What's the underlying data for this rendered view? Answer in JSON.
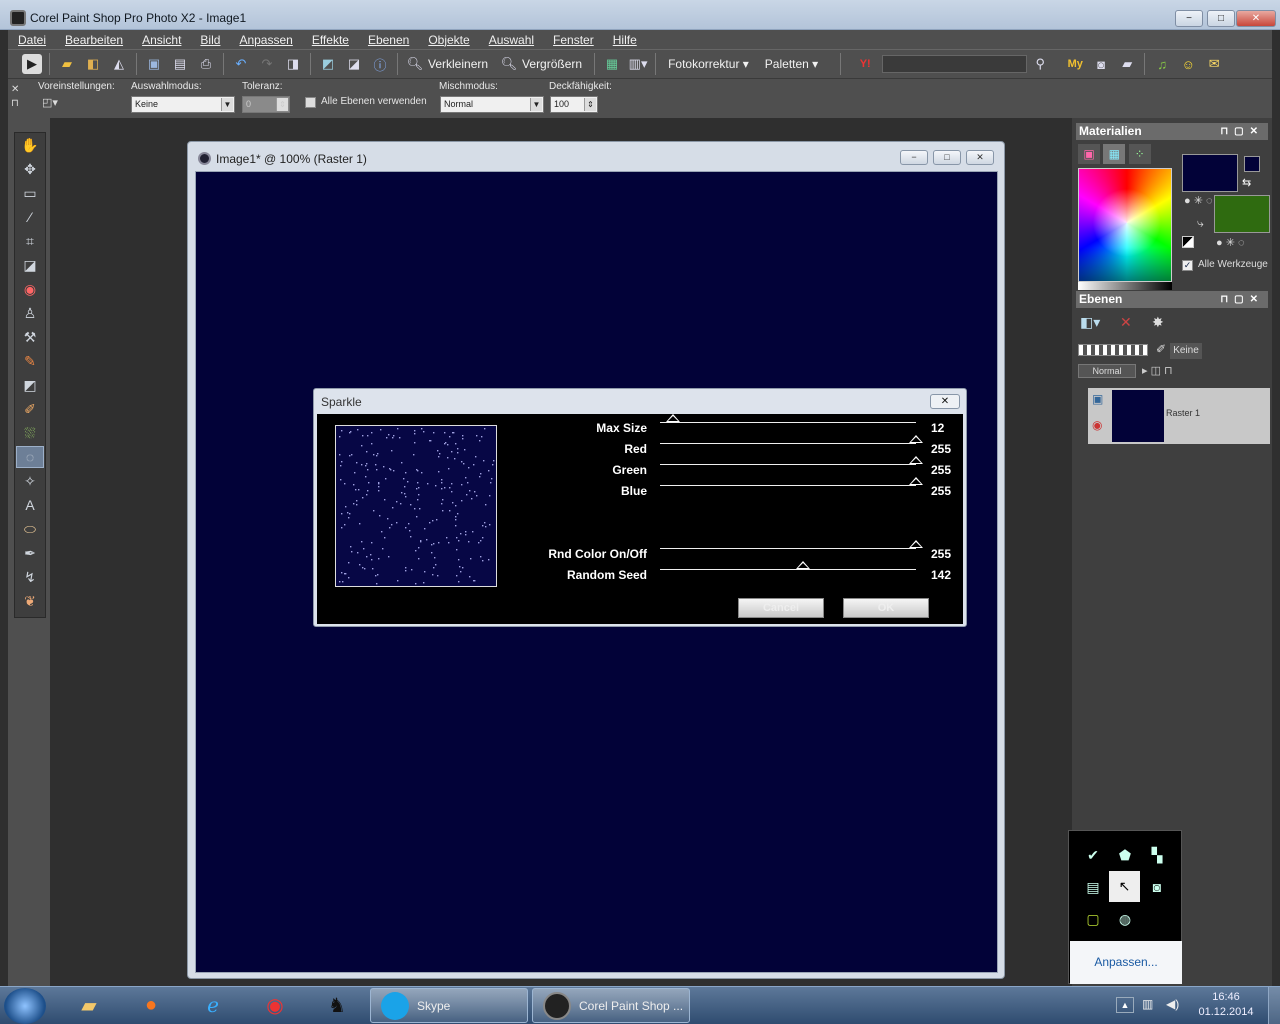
{
  "window": {
    "title": "Corel Paint Shop Pro Photo X2 - Image1",
    "min": "−",
    "max": "□",
    "close": "✕"
  },
  "menu": [
    "Datei",
    "Bearbeiten",
    "Ansicht",
    "Bild",
    "Anpassen",
    "Effekte",
    "Ebenen",
    "Objekte",
    "Auswahl",
    "Fenster",
    "Hilfe"
  ],
  "toolbar": {
    "zoom_out": "Verkleinern",
    "zoom_in": "Vergrößern",
    "photo_fix": "Fotokorrektur",
    "palettes": "Paletten",
    "search_value": ""
  },
  "options": {
    "presets_label": "Voreinstellungen:",
    "selection_mode_label": "Auswahlmodus:",
    "selection_mode_value": "Keine",
    "tolerance_label": "Toleranz:",
    "tolerance_value": "0",
    "all_layers_label": "Alle Ebenen verwenden",
    "blend_label": "Mischmodus:",
    "blend_value": "Normal",
    "opacity_label": "Deckfähigkeit:",
    "opacity_value": "100"
  },
  "image_window": {
    "title": "Image1* @ 100% (Raster 1)",
    "canvas_color": "#020238"
  },
  "dialog": {
    "title": "Sparkle",
    "close": "✕",
    "sliders": [
      {
        "label": "Max Size",
        "value": "12",
        "level": 0.05
      },
      {
        "label": "Red",
        "value": "255",
        "level": 1.0
      },
      {
        "label": "Green",
        "value": "255",
        "level": 1.0
      },
      {
        "label": "Blue",
        "value": "255",
        "level": 1.0
      },
      {
        "label": "Rnd Color On/Off",
        "value": "255",
        "level": 1.0
      },
      {
        "label": "Random Seed",
        "value": "142",
        "level": 0.56
      }
    ],
    "cancel": "Cancel",
    "ok": "OK"
  },
  "materials": {
    "title": "Materialien",
    "foreground": "#020238",
    "background": "#2f6b10",
    "all_tools": "Alle Werkzeuge"
  },
  "layers": {
    "title": "Ebenen",
    "mask": "Keine",
    "blend": "Normal",
    "layer_name": "Raster 1"
  },
  "tray": {
    "customize": "Anpassen..."
  },
  "taskbar": {
    "skype": "Skype",
    "psp": "Corel Paint Shop ...",
    "time": "16:46",
    "date": "01.12.2014"
  }
}
